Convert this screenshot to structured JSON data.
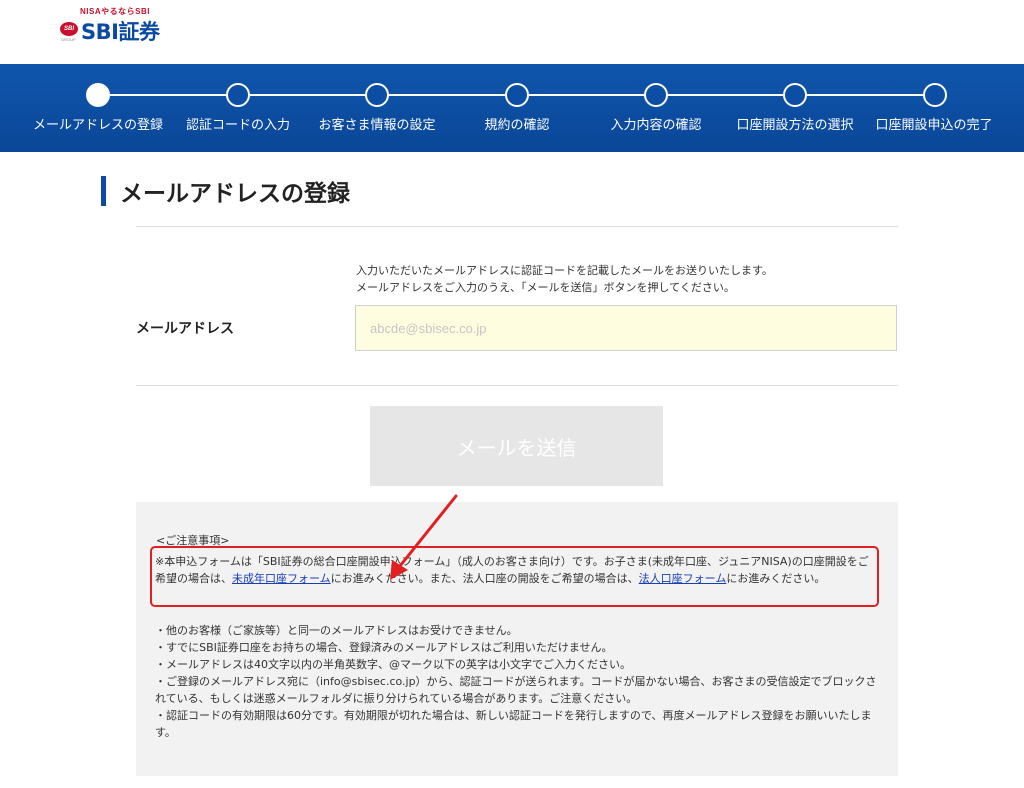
{
  "header": {
    "logo_tagline": "NISAやるならSBI",
    "logo_badge": "SBI",
    "logo_sub": "GROUP",
    "logo_text": "SBI証券"
  },
  "stepper": {
    "steps": [
      {
        "label": "メールアドレスの登録",
        "active": true
      },
      {
        "label": "認証コードの入力",
        "active": false
      },
      {
        "label": "お客さま情報の設定",
        "active": false
      },
      {
        "label": "規約の確認",
        "active": false
      },
      {
        "label": "入力内容の確認",
        "active": false
      },
      {
        "label": "口座開設方法の選択",
        "active": false
      },
      {
        "label": "口座開設申込の完了",
        "active": false
      }
    ]
  },
  "main": {
    "title": "メールアドレスの登録",
    "instructions": [
      "入力いただいたメールアドレスに認証コードを記載したメールをお送りいたします。",
      "メールアドレスをご入力のうえ、「メールを送信」ボタンを押してください。"
    ],
    "email_label": "メールアドレス",
    "email_placeholder": "abcde@sbisec.co.jp",
    "email_value": "",
    "send_button": "メールを送信"
  },
  "notes": {
    "heading": "<ご注意事項>",
    "para_part1": "※本申込フォームは「SBI証券の総合口座開設申込フォーム」（成人のお客さま向け）です。お子さま(未成年口座、ジュニアNISA)の口座開設をご希望の場合は、",
    "minor_link": "未成年口座フォーム",
    "para_part2": "にお進みください。また、法人口座の開設をご希望の場合は、",
    "corporate_link": "法人口座フォーム",
    "para_part3": "にお進みください。",
    "items": [
      "・他のお客様（ご家族等）と同一のメールアドレスはお受けできません。",
      "・すでにSBI証券口座をお持ちの場合、登録済みのメールアドレスはご利用いただけません。",
      "・メールアドレスは40文字以内の半角英数字、@マーク以下の英字は小文字でご入力ください。",
      "・ご登録のメールアドレス宛に（info@sbisec.co.jp）から、認証コードが送られます。コードが届かない場合、お客さまの受信設定でブロックされている、もしくは迷惑メールフォルダに振り分けられている場合があります。ご注意ください。",
      "・認証コードの有効期限は60分です。有効期限が切れた場合は、新しい認証コードを発行しますので、再度メールアドレス登録をお願いいたします。"
    ]
  },
  "colors": {
    "brand_blue": "#0b4aa2",
    "input_bg": "#fffde0",
    "annotation_red": "#e02020",
    "link": "#1a3fb5"
  }
}
